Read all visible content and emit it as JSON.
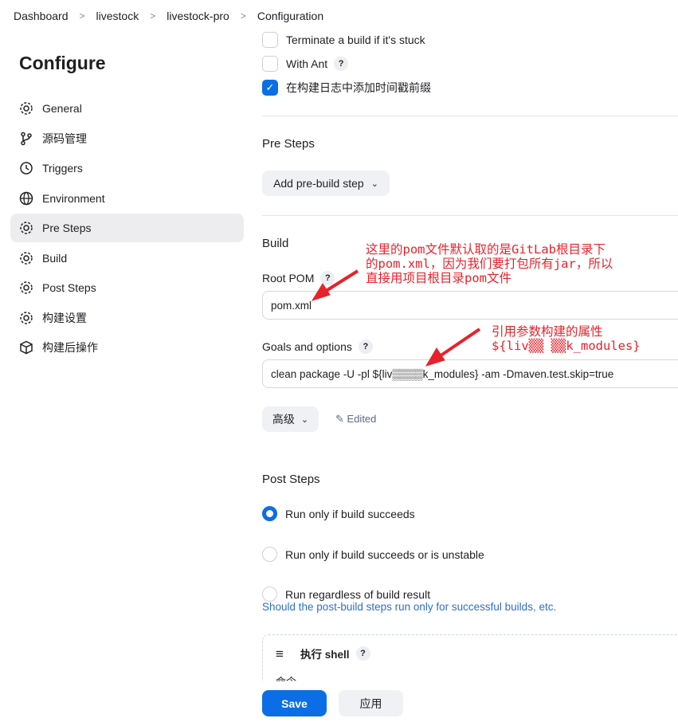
{
  "breadcrumb": [
    "Dashboard",
    "livestock",
    "livestock-pro",
    "Configuration"
  ],
  "sidebar": {
    "title": "Configure",
    "items": [
      {
        "label": "General",
        "icon": "gear-icon"
      },
      {
        "label": "源码管理",
        "icon": "branch-icon"
      },
      {
        "label": "Triggers",
        "icon": "clock-icon"
      },
      {
        "label": "Environment",
        "icon": "globe-icon"
      },
      {
        "label": "Pre Steps",
        "icon": "gear-icon",
        "active": true
      },
      {
        "label": "Build",
        "icon": "gear-icon"
      },
      {
        "label": "Post Steps",
        "icon": "gear-icon"
      },
      {
        "label": "构建设置",
        "icon": "gear-icon"
      },
      {
        "label": "构建后操作",
        "icon": "cube-icon"
      }
    ]
  },
  "options": {
    "terminate": "Terminate a build if it's stuck",
    "ant": "With Ant",
    "timestamp": "在构建日志中添加时间戳前缀"
  },
  "pre_steps": {
    "title": "Pre Steps",
    "add": "Add pre-build step"
  },
  "build": {
    "title": "Build",
    "root_pom_label": "Root POM",
    "root_pom": "pom.xml",
    "goals_label": "Goals and options",
    "goals": "clean package -U -pl ${liv▒▒▒▒k_modules} -am -Dmaven.test.skip=true",
    "advanced": "高级",
    "edited": "Edited"
  },
  "post_steps": {
    "title": "Post Steps",
    "options": [
      "Run only if build succeeds",
      "Run only if build succeeds or is unstable",
      "Run regardless of build result"
    ],
    "hint": "Should the post-build steps run only for successful builds, etc."
  },
  "shell": {
    "title": "执行 shell",
    "command_label": "命令"
  },
  "footer": {
    "save": "Save",
    "apply": "应用"
  },
  "annotations": {
    "a1": [
      "这里的pom文件默认取的是GitLab根目录下",
      "的pom.xml，因为我们要打包所有jar，所以",
      "直接用项目根目录pom文件"
    ],
    "a2": [
      "引用参数构建的属性",
      "${liv▒▒ ▒▒k_modules}"
    ]
  },
  "colors": {
    "accent": "#0b6ee6",
    "annotation": "#e8222a"
  }
}
